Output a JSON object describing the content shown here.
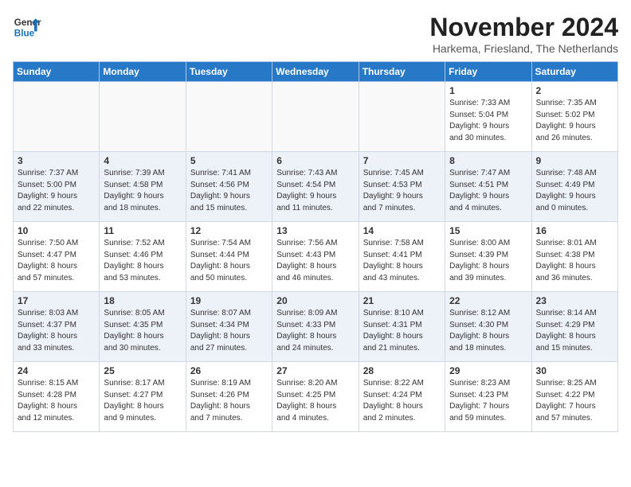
{
  "header": {
    "logo_line1": "General",
    "logo_line2": "Blue",
    "month": "November 2024",
    "location": "Harkema, Friesland, The Netherlands"
  },
  "weekdays": [
    "Sunday",
    "Monday",
    "Tuesday",
    "Wednesday",
    "Thursday",
    "Friday",
    "Saturday"
  ],
  "weeks": [
    [
      {
        "day": "",
        "info": ""
      },
      {
        "day": "",
        "info": ""
      },
      {
        "day": "",
        "info": ""
      },
      {
        "day": "",
        "info": ""
      },
      {
        "day": "",
        "info": ""
      },
      {
        "day": "1",
        "info": "Sunrise: 7:33 AM\nSunset: 5:04 PM\nDaylight: 9 hours\nand 30 minutes."
      },
      {
        "day": "2",
        "info": "Sunrise: 7:35 AM\nSunset: 5:02 PM\nDaylight: 9 hours\nand 26 minutes."
      }
    ],
    [
      {
        "day": "3",
        "info": "Sunrise: 7:37 AM\nSunset: 5:00 PM\nDaylight: 9 hours\nand 22 minutes."
      },
      {
        "day": "4",
        "info": "Sunrise: 7:39 AM\nSunset: 4:58 PM\nDaylight: 9 hours\nand 18 minutes."
      },
      {
        "day": "5",
        "info": "Sunrise: 7:41 AM\nSunset: 4:56 PM\nDaylight: 9 hours\nand 15 minutes."
      },
      {
        "day": "6",
        "info": "Sunrise: 7:43 AM\nSunset: 4:54 PM\nDaylight: 9 hours\nand 11 minutes."
      },
      {
        "day": "7",
        "info": "Sunrise: 7:45 AM\nSunset: 4:53 PM\nDaylight: 9 hours\nand 7 minutes."
      },
      {
        "day": "8",
        "info": "Sunrise: 7:47 AM\nSunset: 4:51 PM\nDaylight: 9 hours\nand 4 minutes."
      },
      {
        "day": "9",
        "info": "Sunrise: 7:48 AM\nSunset: 4:49 PM\nDaylight: 9 hours\nand 0 minutes."
      }
    ],
    [
      {
        "day": "10",
        "info": "Sunrise: 7:50 AM\nSunset: 4:47 PM\nDaylight: 8 hours\nand 57 minutes."
      },
      {
        "day": "11",
        "info": "Sunrise: 7:52 AM\nSunset: 4:46 PM\nDaylight: 8 hours\nand 53 minutes."
      },
      {
        "day": "12",
        "info": "Sunrise: 7:54 AM\nSunset: 4:44 PM\nDaylight: 8 hours\nand 50 minutes."
      },
      {
        "day": "13",
        "info": "Sunrise: 7:56 AM\nSunset: 4:43 PM\nDaylight: 8 hours\nand 46 minutes."
      },
      {
        "day": "14",
        "info": "Sunrise: 7:58 AM\nSunset: 4:41 PM\nDaylight: 8 hours\nand 43 minutes."
      },
      {
        "day": "15",
        "info": "Sunrise: 8:00 AM\nSunset: 4:39 PM\nDaylight: 8 hours\nand 39 minutes."
      },
      {
        "day": "16",
        "info": "Sunrise: 8:01 AM\nSunset: 4:38 PM\nDaylight: 8 hours\nand 36 minutes."
      }
    ],
    [
      {
        "day": "17",
        "info": "Sunrise: 8:03 AM\nSunset: 4:37 PM\nDaylight: 8 hours\nand 33 minutes."
      },
      {
        "day": "18",
        "info": "Sunrise: 8:05 AM\nSunset: 4:35 PM\nDaylight: 8 hours\nand 30 minutes."
      },
      {
        "day": "19",
        "info": "Sunrise: 8:07 AM\nSunset: 4:34 PM\nDaylight: 8 hours\nand 27 minutes."
      },
      {
        "day": "20",
        "info": "Sunrise: 8:09 AM\nSunset: 4:33 PM\nDaylight: 8 hours\nand 24 minutes."
      },
      {
        "day": "21",
        "info": "Sunrise: 8:10 AM\nSunset: 4:31 PM\nDaylight: 8 hours\nand 21 minutes."
      },
      {
        "day": "22",
        "info": "Sunrise: 8:12 AM\nSunset: 4:30 PM\nDaylight: 8 hours\nand 18 minutes."
      },
      {
        "day": "23",
        "info": "Sunrise: 8:14 AM\nSunset: 4:29 PM\nDaylight: 8 hours\nand 15 minutes."
      }
    ],
    [
      {
        "day": "24",
        "info": "Sunrise: 8:15 AM\nSunset: 4:28 PM\nDaylight: 8 hours\nand 12 minutes."
      },
      {
        "day": "25",
        "info": "Sunrise: 8:17 AM\nSunset: 4:27 PM\nDaylight: 8 hours\nand 9 minutes."
      },
      {
        "day": "26",
        "info": "Sunrise: 8:19 AM\nSunset: 4:26 PM\nDaylight: 8 hours\nand 7 minutes."
      },
      {
        "day": "27",
        "info": "Sunrise: 8:20 AM\nSunset: 4:25 PM\nDaylight: 8 hours\nand 4 minutes."
      },
      {
        "day": "28",
        "info": "Sunrise: 8:22 AM\nSunset: 4:24 PM\nDaylight: 8 hours\nand 2 minutes."
      },
      {
        "day": "29",
        "info": "Sunrise: 8:23 AM\nSunset: 4:23 PM\nDaylight: 7 hours\nand 59 minutes."
      },
      {
        "day": "30",
        "info": "Sunrise: 8:25 AM\nSunset: 4:22 PM\nDaylight: 7 hours\nand 57 minutes."
      }
    ]
  ]
}
